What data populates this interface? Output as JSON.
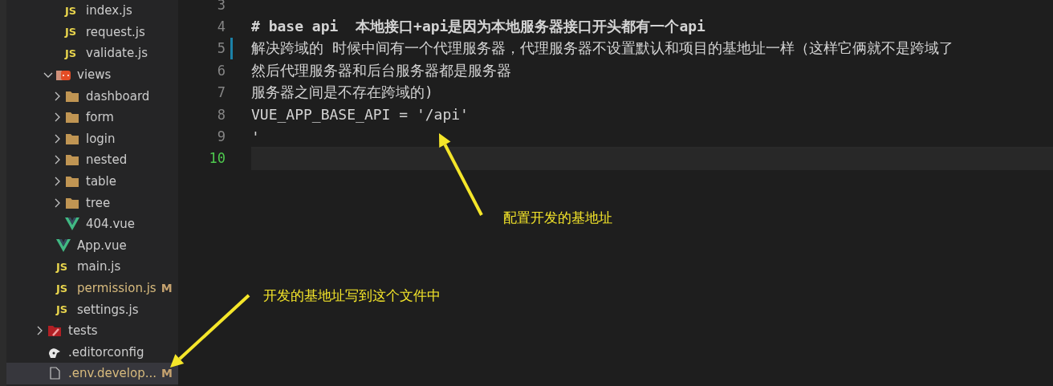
{
  "explorer": {
    "tree": [
      {
        "children": [
          {
            "children": [
              {
                "name": "index.js",
                "kind": "js",
                "icon_text": "JS",
                "modified": false,
                "selected": false
              },
              {
                "name": "request.js",
                "kind": "js",
                "icon_text": "JS",
                "modified": false,
                "selected": false
              },
              {
                "name": "validate.js",
                "kind": "js",
                "icon_text": "JS",
                "modified": false,
                "selected": false
              }
            ]
          },
          {
            "name": "views",
            "kind": "views-folder",
            "expanded": true,
            "modified": false,
            "selected": false,
            "children": [
              {
                "name": "dashboard",
                "kind": "folder",
                "expanded": false,
                "modified": false,
                "selected": false
              },
              {
                "name": "form",
                "kind": "folder",
                "expanded": false,
                "modified": false,
                "selected": false
              },
              {
                "name": "login",
                "kind": "folder",
                "expanded": false,
                "modified": false,
                "selected": false
              },
              {
                "name": "nested",
                "kind": "folder",
                "expanded": false,
                "modified": false,
                "selected": false
              },
              {
                "name": "table",
                "kind": "folder",
                "expanded": false,
                "modified": false,
                "selected": false
              },
              {
                "name": "tree",
                "kind": "folder",
                "expanded": false,
                "modified": false,
                "selected": false
              },
              {
                "name": "404.vue",
                "kind": "vue",
                "modified": false,
                "selected": false
              }
            ]
          },
          {
            "name": "App.vue",
            "kind": "vue",
            "modified": false,
            "selected": false
          },
          {
            "name": "main.js",
            "kind": "js",
            "icon_text": "JS",
            "modified": false,
            "selected": false
          },
          {
            "name": "permission.js",
            "kind": "js",
            "icon_text": "JS",
            "modified": true,
            "badge": "M",
            "selected": false
          },
          {
            "name": "settings.js",
            "kind": "js",
            "icon_text": "JS",
            "modified": false,
            "selected": false
          }
        ]
      },
      {
        "name": "tests",
        "kind": "tests-folder",
        "expanded": false,
        "modified": false,
        "selected": false
      },
      {
        "name": ".editorconfig",
        "kind": "config",
        "modified": false,
        "selected": false
      },
      {
        "name": ".env.develop...",
        "kind": "file",
        "modified": true,
        "badge": "M",
        "selected": true
      }
    ]
  },
  "editor": {
    "lines": [
      {
        "number": "3",
        "kind": "plain",
        "changed": false,
        "current": false
      },
      {
        "number": "4",
        "text": "# base api  本地接口+api是因为本地服务器接口开头都有一个api",
        "kind": "heading",
        "changed": false,
        "current": false
      },
      {
        "number": "5",
        "text": "解决跨域的 时候中间有一个代理服务器，代理服务器不设置默认和项目的基地址一样（这样它俩就不是跨域了",
        "kind": "plain",
        "changed": true,
        "current": false
      },
      {
        "number": "6",
        "text": "然后代理服务器和后台服务器都是服务器",
        "kind": "plain",
        "changed": false,
        "current": false
      },
      {
        "number": "7",
        "text": "服务器之间是不存在跨域的)",
        "kind": "plain",
        "changed": false,
        "current": false
      },
      {
        "number": "8",
        "text": "VUE_APP_BASE_API = '/api'",
        "kind": "plain",
        "changed": false,
        "current": false
      },
      {
        "number": "9",
        "text": "'",
        "kind": "plain",
        "changed": false,
        "current": false
      },
      {
        "number": "10",
        "kind": "plain",
        "changed": false,
        "current": true
      }
    ]
  },
  "annotations": [
    {
      "text": "配置开发的基地址",
      "kind": "up-left"
    },
    {
      "text": "开发的基地址写到这个文件中",
      "kind": "down-left"
    }
  ]
}
